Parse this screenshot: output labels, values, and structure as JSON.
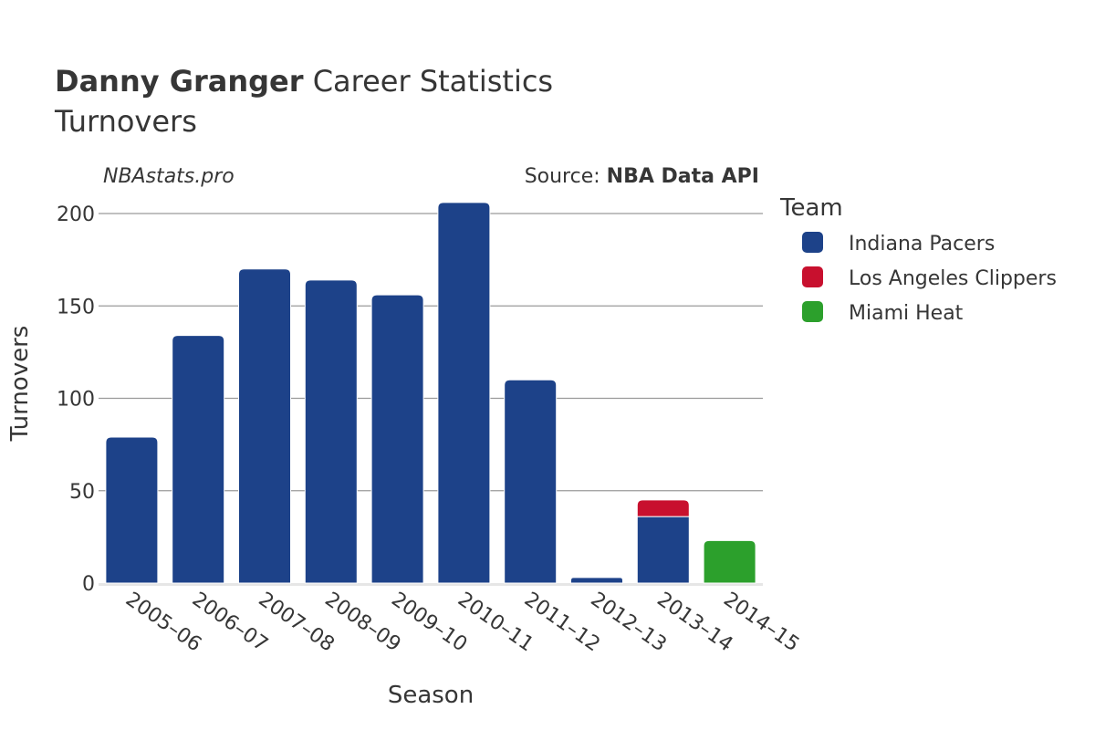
{
  "header": {
    "title_bold": "Danny Granger",
    "title_rest": " Career Statistics",
    "subtitle": "Turnovers",
    "watermark": "NBAstats.pro",
    "source_prefix": "Source: ",
    "source_bold": "NBA Data API"
  },
  "legend": {
    "title": "Team",
    "items": [
      {
        "label": "Indiana Pacers",
        "color": "#1d4289"
      },
      {
        "label": "Los Angeles Clippers",
        "color": "#c8102e"
      },
      {
        "label": "Miami Heat",
        "color": "#2ca02c"
      }
    ]
  },
  "chart_data": {
    "type": "bar",
    "stacked": true,
    "title": "Danny Granger Career Statistics",
    "subtitle": "Turnovers",
    "xlabel": "Season",
    "ylabel": "Turnovers",
    "ylim": [
      0,
      210
    ],
    "yticks": [
      0,
      50,
      100,
      150,
      200
    ],
    "grid": true,
    "legend_position": "right",
    "categories": [
      "2005-06",
      "2006-07",
      "2007-08",
      "2008-09",
      "2009-10",
      "2010-11",
      "2011-12",
      "2012-13",
      "2013-14",
      "2014-15"
    ],
    "series": [
      {
        "name": "Indiana Pacers",
        "color": "#1d4289",
        "values": [
          79,
          134,
          170,
          164,
          156,
          206,
          110,
          3,
          36,
          0
        ]
      },
      {
        "name": "Los Angeles Clippers",
        "color": "#c8102e",
        "values": [
          0,
          0,
          0,
          0,
          0,
          0,
          0,
          0,
          9,
          0
        ]
      },
      {
        "name": "Miami Heat",
        "color": "#2ca02c",
        "values": [
          0,
          0,
          0,
          0,
          0,
          0,
          0,
          0,
          0,
          23
        ]
      }
    ]
  }
}
